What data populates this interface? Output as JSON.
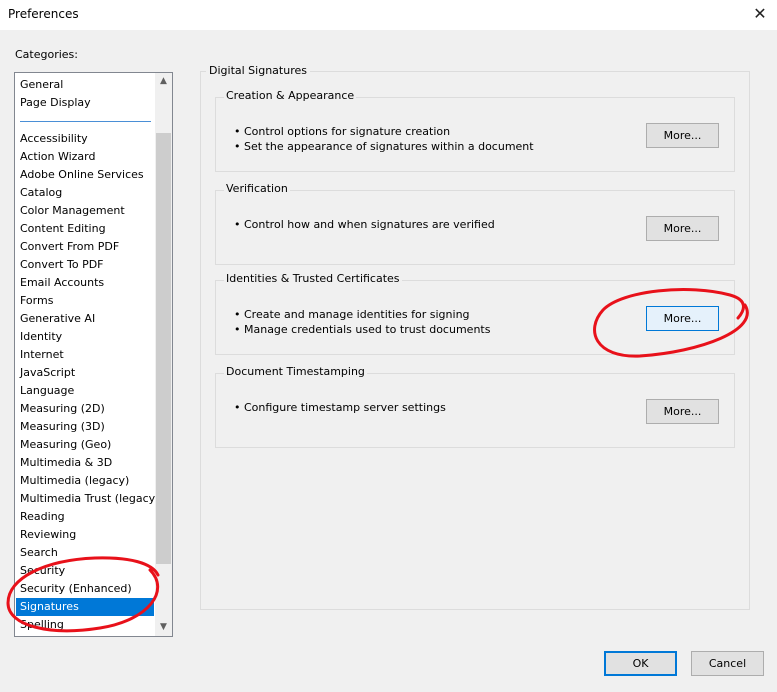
{
  "window": {
    "title": "Preferences",
    "close_glyph": "✕"
  },
  "categories": {
    "label": "Categories:",
    "pinned": [
      "General",
      "Page Display"
    ],
    "items": [
      "Accessibility",
      "Action Wizard",
      "Adobe Online Services",
      "Catalog",
      "Color Management",
      "Content Editing",
      "Convert From PDF",
      "Convert To PDF",
      "Email Accounts",
      "Forms",
      "Generative AI",
      "Identity",
      "Internet",
      "JavaScript",
      "Language",
      "Measuring (2D)",
      "Measuring (3D)",
      "Measuring (Geo)",
      "Multimedia & 3D",
      "Multimedia (legacy)",
      "Multimedia Trust (legacy)",
      "Reading",
      "Reviewing",
      "Search",
      "Security",
      "Security (Enhanced)",
      "Signatures",
      "Spelling"
    ],
    "selected": "Signatures",
    "scroll_up_glyph": "▲",
    "scroll_down_glyph": "▼"
  },
  "panel": {
    "title": "Digital Signatures",
    "groups": [
      {
        "title": "Creation & Appearance",
        "bullets": [
          "• Control options for signature creation",
          "• Set the appearance of signatures within a document"
        ],
        "button": "More..."
      },
      {
        "title": "Verification",
        "bullets": [
          "• Control how and when signatures are verified"
        ],
        "button": "More..."
      },
      {
        "title": "Identities & Trusted Certificates",
        "bullets": [
          "• Create and manage identities for signing",
          "• Manage credentials used to trust documents"
        ],
        "button": "More..."
      },
      {
        "title": "Document Timestamping",
        "bullets": [
          "• Configure timestamp server settings"
        ],
        "button": "More..."
      }
    ]
  },
  "footer": {
    "ok_label": "OK",
    "cancel_label": "Cancel"
  },
  "colors": {
    "accent": "#0078d7",
    "annotation": "#e8111a"
  },
  "icons": {
    "close": "close-icon",
    "scroll_up": "chevron-up-icon",
    "scroll_down": "chevron-down-icon"
  }
}
